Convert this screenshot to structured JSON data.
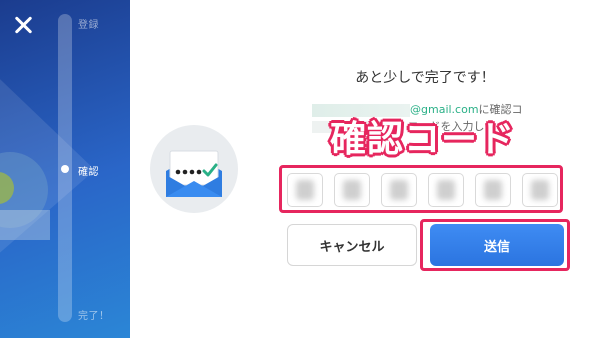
{
  "sidebar": {
    "steps": [
      {
        "label": "登録"
      },
      {
        "label": "確認"
      },
      {
        "label": "完了！"
      }
    ],
    "current_step": 2,
    "total_steps": 3
  },
  "main": {
    "title": "あと少しで完了です！",
    "email_domain": "@gmail.com",
    "email_suffix": "に確認コ",
    "sub_text": "コードを入力し",
    "overlay_label": "確認コード",
    "code_slots": 6,
    "cancel_label": "キャンセル",
    "send_label": "送信"
  },
  "colors": {
    "accent": "#2b74e0",
    "highlight": "#e6265e",
    "check": "#2ab087",
    "envelope": "#2f7de1"
  },
  "icons": [
    "close-icon",
    "envelope-icon",
    "checkmark-icon"
  ]
}
